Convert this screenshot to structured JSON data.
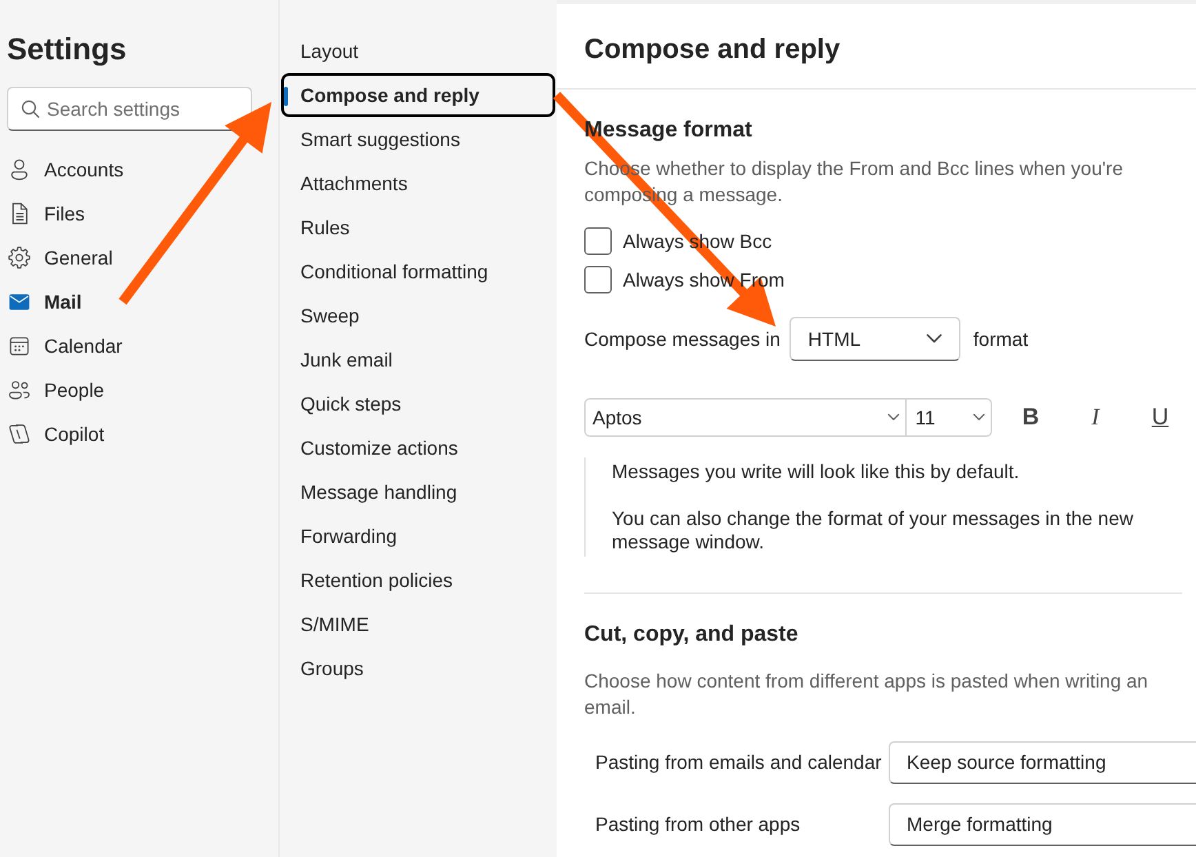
{
  "sidebar": {
    "title": "Settings",
    "search": {
      "placeholder": "Search settings"
    },
    "items": [
      {
        "label": "Accounts",
        "selected": false
      },
      {
        "label": "Files",
        "selected": false
      },
      {
        "label": "General",
        "selected": false
      },
      {
        "label": "Mail",
        "selected": true
      },
      {
        "label": "Calendar",
        "selected": false
      },
      {
        "label": "People",
        "selected": false
      },
      {
        "label": "Copilot",
        "selected": false
      }
    ]
  },
  "mail_nav": {
    "items": [
      {
        "label": "Layout",
        "selected": false
      },
      {
        "label": "Compose and reply",
        "selected": true
      },
      {
        "label": "Smart suggestions",
        "selected": false
      },
      {
        "label": "Attachments",
        "selected": false
      },
      {
        "label": "Rules",
        "selected": false
      },
      {
        "label": "Conditional formatting",
        "selected": false
      },
      {
        "label": "Sweep",
        "selected": false
      },
      {
        "label": "Junk email",
        "selected": false
      },
      {
        "label": "Quick steps",
        "selected": false
      },
      {
        "label": "Customize actions",
        "selected": false
      },
      {
        "label": "Message handling",
        "selected": false
      },
      {
        "label": "Forwarding",
        "selected": false
      },
      {
        "label": "Retention policies",
        "selected": false
      },
      {
        "label": "S/MIME",
        "selected": false
      },
      {
        "label": "Groups",
        "selected": false
      }
    ]
  },
  "page": {
    "title": "Compose and reply"
  },
  "message_format": {
    "heading": "Message format",
    "description": "Choose whether to display the From and Bcc lines when you're composing a message.",
    "checkboxes": [
      {
        "label": "Always show Bcc",
        "checked": false
      },
      {
        "label": "Always show From",
        "checked": false
      }
    ],
    "compose_format": {
      "label": "Compose messages in",
      "value": "HTML",
      "suffix": "format"
    },
    "font_toolbar": {
      "font": "Aptos",
      "size": "11",
      "buttons": [
        {
          "label": "B",
          "kind": "bold"
        },
        {
          "label": "I",
          "kind": "italic"
        },
        {
          "label": "U",
          "kind": "underline"
        }
      ]
    },
    "preview": [
      "Messages you write will look like this by default.",
      "You can also change the format of your messages in the new message window."
    ]
  },
  "cut_copy_paste": {
    "heading": "Cut, copy, and paste",
    "description": "Choose how content from different apps is pasted when writing an email.",
    "rows": [
      {
        "label": "Pasting from emails and calendar",
        "value": "Keep source formatting"
      },
      {
        "label": "Pasting from other apps",
        "value": "Merge formatting"
      }
    ]
  },
  "annotations": [
    {
      "kind": "arrow"
    },
    {
      "kind": "arrow"
    }
  ]
}
